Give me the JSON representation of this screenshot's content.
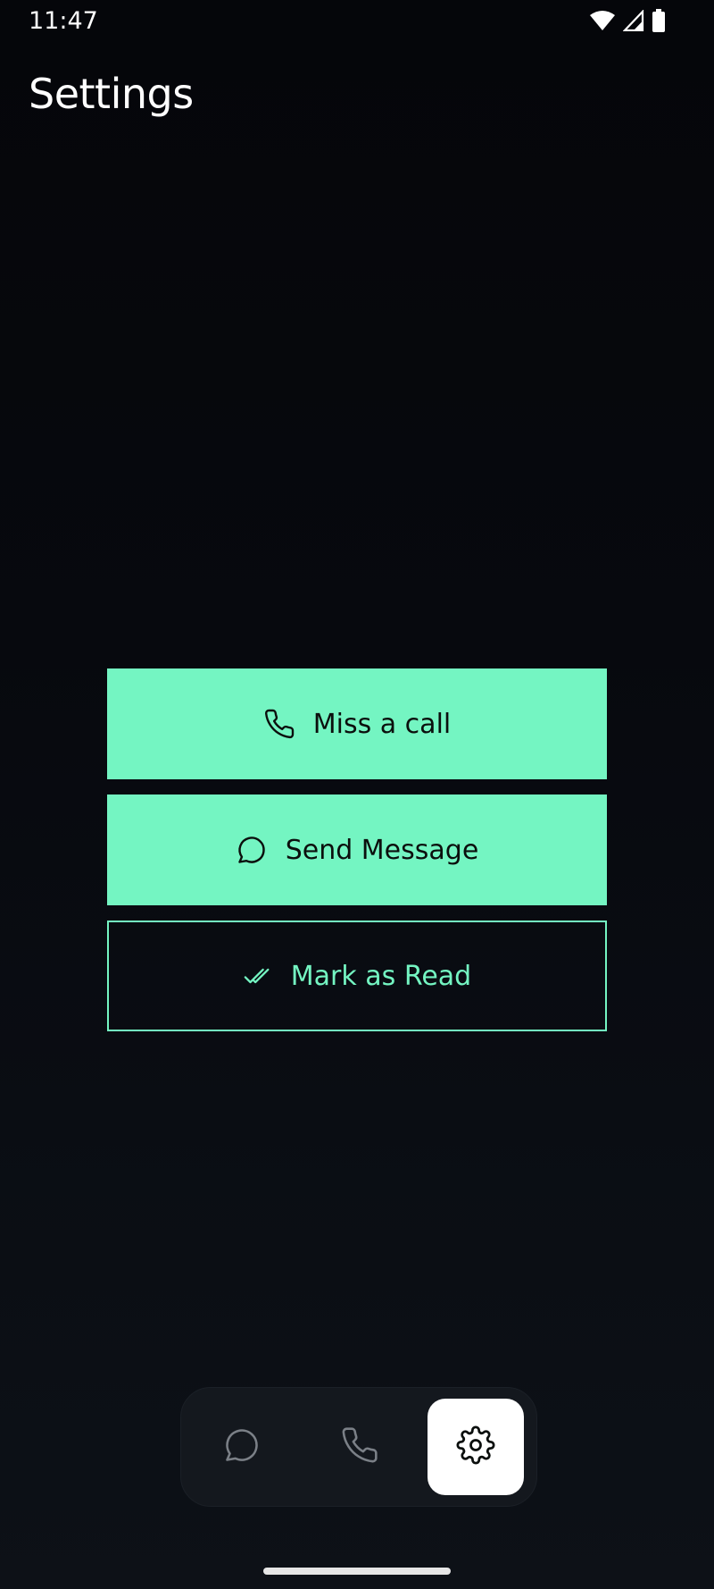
{
  "status_bar": {
    "time": "11:47",
    "icons": [
      "wifi-icon",
      "signal-icon",
      "battery-icon"
    ]
  },
  "header": {
    "title": "Settings"
  },
  "actions": [
    {
      "label": "Miss a call",
      "icon": "phone-icon",
      "style": "filled"
    },
    {
      "label": "Send Message",
      "icon": "chat-bubble-icon",
      "style": "filled"
    },
    {
      "label": "Mark as Read",
      "icon": "double-check-icon",
      "style": "outline"
    }
  ],
  "bottom_nav": {
    "items": [
      {
        "icon": "chat-bubble-icon",
        "active": false
      },
      {
        "icon": "phone-icon",
        "active": false
      },
      {
        "icon": "gear-icon",
        "active": true
      }
    ]
  },
  "colors": {
    "accent": "#74f5c2",
    "background": "#05060a",
    "nav_background": "#14181e",
    "active_nav": "#ffffff"
  }
}
